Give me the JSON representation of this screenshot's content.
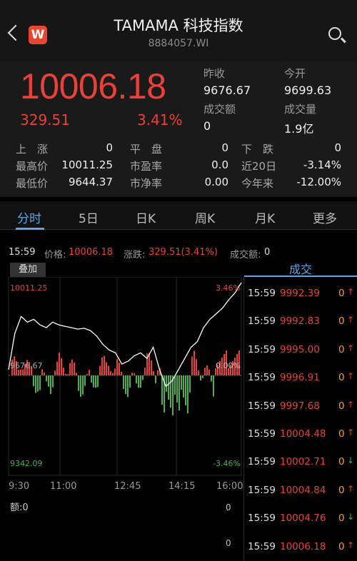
{
  "header": {
    "title": "TAMAMA 科技指数",
    "subtitle": "8884057.WI",
    "logo_text": "W",
    "icons": [
      "chevron-left-icon",
      "search-icon"
    ]
  },
  "quote": {
    "price": "10006.18",
    "change": "329.51",
    "change_pct": "3.41%",
    "prev_close_label": "昨收",
    "prev_close": "9676.67",
    "open_label": "今开",
    "open": "9699.63",
    "amount_label": "成交额",
    "amount": "0",
    "volume_label": "成交量",
    "volume": "1.9亿",
    "up_color": "#e8413a",
    "down_color": "#4caf50"
  },
  "stats": {
    "rise_label": "上　涨",
    "rise": "0",
    "flat_label": "平　盘",
    "flat": "0",
    "fall_label": "下　跌",
    "fall": "0",
    "high_label": "最高价",
    "high": "10011.25",
    "pe_label": "市盈率",
    "pe": "0.0",
    "d20_label": "近20日",
    "d20": "-3.14%",
    "low_label": "最低价",
    "low": "9644.37",
    "pb_label": "市净率",
    "pb": "0.00",
    "ytd_label": "今年来",
    "ytd": "-12.00%"
  },
  "tabs": [
    "分时",
    "5日",
    "日K",
    "周K",
    "月K",
    "更多"
  ],
  "active_tab": 0,
  "info": {
    "time": "15:59",
    "price_label": "价格:",
    "price": "10006.18",
    "chg_label": "涨跌:",
    "chg": "329.51(3.41%)",
    "vol_label": "成交额:",
    "vol": "0"
  },
  "chart": {
    "overlay_label": "叠加",
    "top_left": "10011.25",
    "top_right": "3.46%",
    "mid_left": "9676.67",
    "mid_right": "0.00%",
    "bottom_left": "9342.09",
    "bottom_right": "-3.46%",
    "x_labels": [
      "9:30",
      "11:00",
      "12:45",
      "14:15",
      "16:00"
    ],
    "lower_label": "额:0",
    "lower_right_top": "0",
    "lower_right_bottom": "0"
  },
  "chart_data": {
    "type": "line",
    "ylim": [
      9342.09,
      10011.25
    ],
    "x": [
      "9:30",
      "11:00",
      "12:45",
      "14:15",
      "16:00"
    ],
    "series": [
      {
        "values": [
          9700,
          9830,
          9890,
          9870,
          9880,
          9860,
          9850,
          9870,
          9860,
          9855,
          9850,
          9845,
          9848,
          9840,
          9820,
          9790,
          9770,
          9760,
          9720,
          9730,
          9750,
          9760,
          9740,
          9780,
          9700,
          9640,
          9660,
          9700,
          9740,
          9780,
          9800,
          9850,
          9880,
          9900,
          9920,
          9950,
          9975,
          10011.25
        ]
      }
    ]
  },
  "trades_header": "成交",
  "trades": [
    {
      "time": "15:59",
      "price": "9992.39",
      "qty": "0",
      "dir": "up"
    },
    {
      "time": "15:59",
      "price": "9992.83",
      "qty": "0",
      "dir": "up"
    },
    {
      "time": "15:59",
      "price": "9995.00",
      "qty": "0",
      "dir": "up"
    },
    {
      "time": "15:59",
      "price": "9996.91",
      "qty": "0",
      "dir": "up"
    },
    {
      "time": "15:59",
      "price": "9997.68",
      "qty": "0",
      "dir": "up"
    },
    {
      "time": "15:59",
      "price": "10004.48",
      "qty": "0",
      "dir": "up"
    },
    {
      "time": "15:59",
      "price": "10002.71",
      "qty": "0",
      "dir": "down"
    },
    {
      "time": "15:59",
      "price": "10004.84",
      "qty": "0",
      "dir": "up"
    },
    {
      "time": "15:59",
      "price": "10004.76",
      "qty": "0",
      "dir": "down"
    },
    {
      "time": "15:59",
      "price": "10006.18",
      "qty": "0",
      "dir": "up"
    }
  ]
}
